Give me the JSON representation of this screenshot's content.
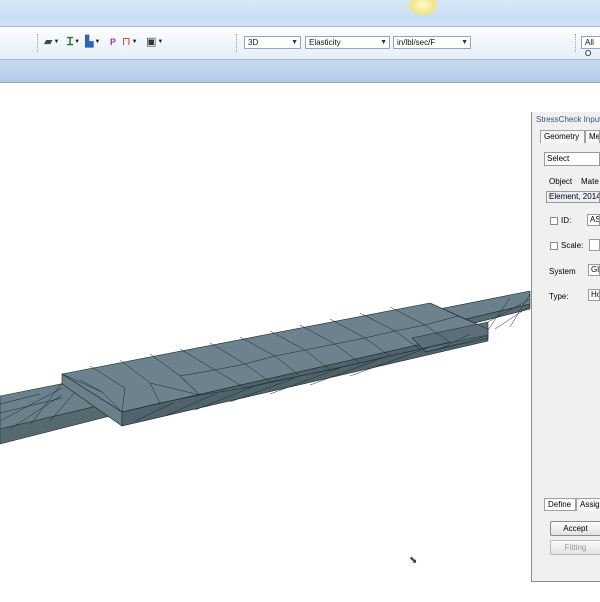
{
  "toolbar": {
    "view_mode": "3D",
    "analysis_type": "Elasticity",
    "units": "in/lbl/sec/F",
    "filter": "All O",
    "icons": [
      "shape-icon",
      "i-beam-icon",
      "assign-icon",
      "p-icon",
      "constraint-icon",
      "load-icon"
    ]
  },
  "panel": {
    "title": "StressCheck Input",
    "tabs": [
      "Geometry",
      "Me"
    ],
    "method_select": "Select",
    "object_label": "Object",
    "material_label": "Mate",
    "object_value": "Element, 2014",
    "id_label": "ID:",
    "id_value": "AS",
    "scale_label": "Scale:",
    "system_label": "System",
    "system_value": "Gl",
    "type_label": "Type:",
    "type_value": "Ho",
    "bottom_tabs": [
      "Define",
      "Assig"
    ],
    "accept_label": "Accept",
    "fitting_label": "Fitting"
  },
  "colors": {
    "mesh_fill": "#5d727c",
    "mesh_edge": "#1b2830",
    "toolbar_bg": "#e6eef9",
    "title_bar": "#c7dcf4"
  }
}
